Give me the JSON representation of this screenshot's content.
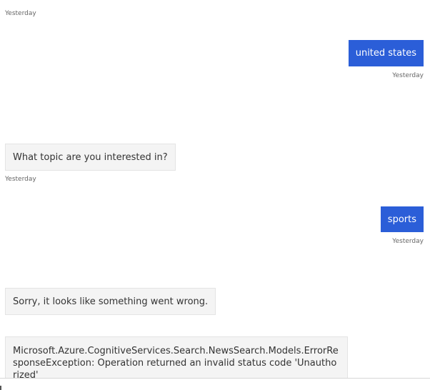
{
  "messages": [
    {
      "timestamp": "Yesterday"
    },
    {
      "sender": "user",
      "text": "united states",
      "timestamp": "Yesterday"
    },
    {
      "sender": "bot",
      "text": "What topic are you interested in?",
      "timestamp": "Yesterday"
    },
    {
      "sender": "user",
      "text": "sports",
      "timestamp": "Yesterday"
    },
    {
      "sender": "bot",
      "text": "Sorry, it looks like something went wrong."
    },
    {
      "sender": "bot",
      "text": "Microsoft.Azure.CognitiveServices.Search.NewsSearch.Models.ErrorResponseException: Operation returned an invalid status code 'Unauthorized'"
    }
  ],
  "colors": {
    "user_bubble": "#2b5ed8",
    "bot_bubble": "#f4f4f4",
    "timestamp": "#666666"
  }
}
